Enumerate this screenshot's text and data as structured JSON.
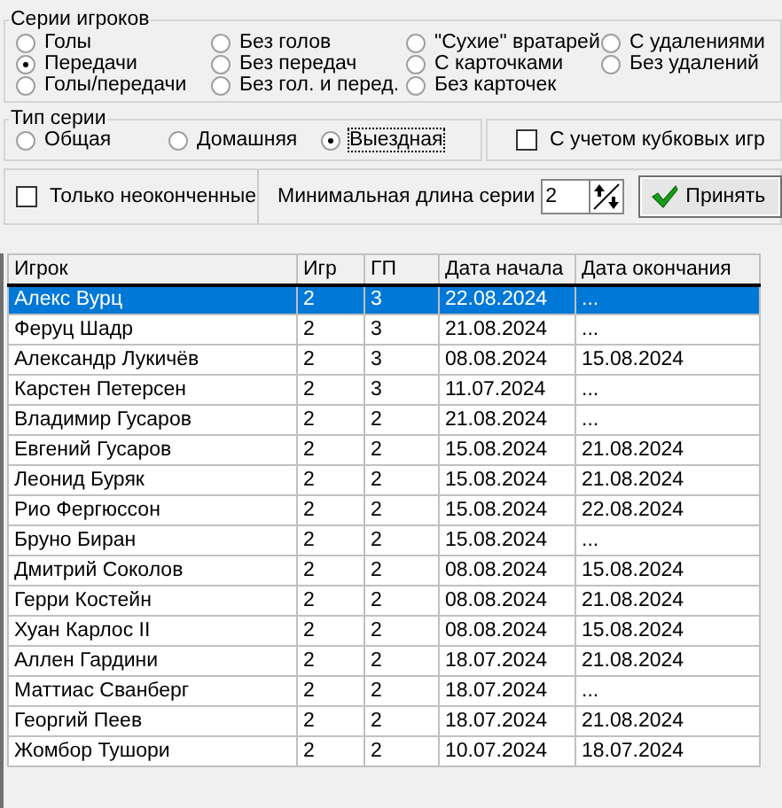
{
  "series_group": {
    "title": "Серии игроков",
    "options": [
      {
        "label": "Голы",
        "selected": false
      },
      {
        "label": "Без голов",
        "selected": false
      },
      {
        "label": "\"Сухие\" вратарей",
        "selected": false
      },
      {
        "label": "С удалениями",
        "selected": false
      },
      {
        "label": "Передачи",
        "selected": true
      },
      {
        "label": "Без передач",
        "selected": false
      },
      {
        "label": "С карточками",
        "selected": false
      },
      {
        "label": "Без удалений",
        "selected": false
      },
      {
        "label": "Голы/передачи",
        "selected": false
      },
      {
        "label": "Без гол. и перед.",
        "selected": false
      },
      {
        "label": "Без карточек",
        "selected": false
      }
    ]
  },
  "type_group": {
    "title": "Тип серии",
    "options": [
      {
        "label": "Общая",
        "selected": false,
        "focused": false
      },
      {
        "label": "Домашняя",
        "selected": false,
        "focused": false
      },
      {
        "label": "Выездная",
        "selected": true,
        "focused": true
      }
    ]
  },
  "cup_games": {
    "label": "С учетом кубковых игр",
    "checked": false
  },
  "unfinished_only": {
    "label": "Только неоконченные",
    "checked": false
  },
  "min_length": {
    "label": "Минимальная длина серии",
    "value": "2"
  },
  "accept_button": {
    "label": "Принять"
  },
  "table": {
    "columns": [
      "Игрок",
      "Игр",
      "ГП",
      "Дата начала",
      "Дата окончания"
    ],
    "rows": [
      {
        "cells": [
          "Алекс Вурц",
          "2",
          "3",
          "22.08.2024",
          "..."
        ],
        "selected": true
      },
      {
        "cells": [
          "Феруц Шадр",
          "2",
          "3",
          "21.08.2024",
          "..."
        ],
        "selected": false
      },
      {
        "cells": [
          "Александр Лукичёв",
          "2",
          "3",
          "08.08.2024",
          "15.08.2024"
        ],
        "selected": false
      },
      {
        "cells": [
          "Карстен Петерсен",
          "2",
          "3",
          "11.07.2024",
          "..."
        ],
        "selected": false
      },
      {
        "cells": [
          "Владимир Гусаров",
          "2",
          "2",
          "21.08.2024",
          "..."
        ],
        "selected": false
      },
      {
        "cells": [
          "Евгений Гусаров",
          "2",
          "2",
          "15.08.2024",
          "21.08.2024"
        ],
        "selected": false
      },
      {
        "cells": [
          "Леонид Буряк",
          "2",
          "2",
          "15.08.2024",
          "21.08.2024"
        ],
        "selected": false
      },
      {
        "cells": [
          "Рио Фергюссон",
          "2",
          "2",
          "15.08.2024",
          "22.08.2024"
        ],
        "selected": false
      },
      {
        "cells": [
          "Бруно Биран",
          "2",
          "2",
          "15.08.2024",
          "..."
        ],
        "selected": false
      },
      {
        "cells": [
          "Дмитрий Соколов",
          "2",
          "2",
          "08.08.2024",
          "15.08.2024"
        ],
        "selected": false
      },
      {
        "cells": [
          "Герри Костейн",
          "2",
          "2",
          "08.08.2024",
          "21.08.2024"
        ],
        "selected": false
      },
      {
        "cells": [
          "Хуан Карлос II",
          "2",
          "2",
          "08.08.2024",
          "15.08.2024"
        ],
        "selected": false
      },
      {
        "cells": [
          "Аллен Гардини",
          "2",
          "2",
          "18.07.2024",
          "21.08.2024"
        ],
        "selected": false
      },
      {
        "cells": [
          "Маттиас Сванберг",
          "2",
          "2",
          "18.07.2024",
          "..."
        ],
        "selected": false
      },
      {
        "cells": [
          "Георгий Пеев",
          "2",
          "2",
          "18.07.2024",
          "21.08.2024"
        ],
        "selected": false
      },
      {
        "cells": [
          "Жомбор Тушори",
          "2",
          "2",
          "10.07.2024",
          "18.07.2024"
        ],
        "selected": false
      }
    ]
  }
}
